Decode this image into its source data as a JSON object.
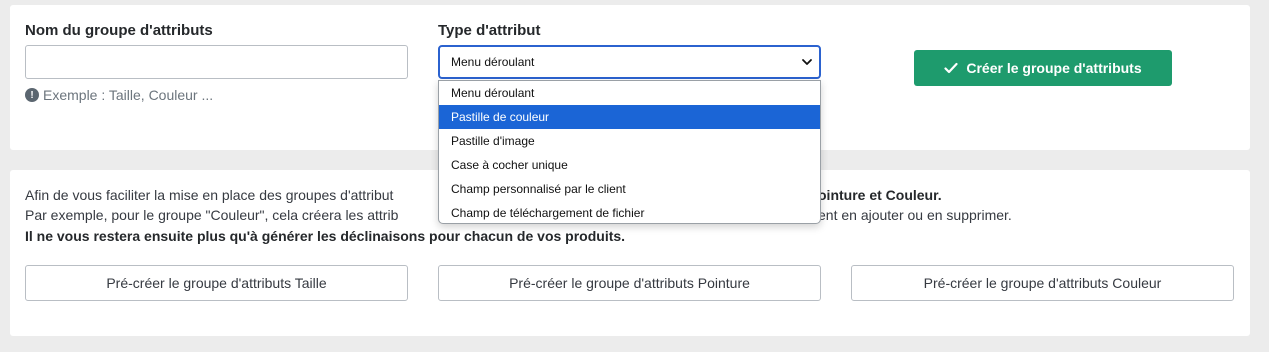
{
  "form": {
    "name_label": "Nom du groupe d'attributs",
    "name_value": "",
    "name_hint": "Exemple : Taille, Couleur ...",
    "type_label": "Type d'attribut",
    "type_selected": "Menu déroulant",
    "type_options": [
      "Menu déroulant",
      "Pastille de couleur",
      "Pastille d'image",
      "Case à cocher unique",
      "Champ personnalisé par le client",
      "Champ de téléchargement de fichier"
    ],
    "highlighted_option_index": 1,
    "create_button_label": "Créer le groupe d'attributs"
  },
  "info": {
    "line1_start": "Afin de vous faciliter la mise en place des groupes d'attribut",
    "line1_bold_tail": "ointure et Couleur.",
    "line2_start": "Par exemple, pour le groupe \"Couleur\", cela créera les attrib",
    "line2_tail": "ent en ajouter ou en supprimer.",
    "line3_bold": "Il ne vous restera ensuite plus qu'à générer les déclinaisons pour chacun de vos produits."
  },
  "precreate_buttons": [
    "Pré-créer le groupe d'attributs Taille",
    "Pré-créer le groupe d'attributs Pointure",
    "Pré-créer le groupe d'attributs Couleur"
  ],
  "colors": {
    "primary_green": "#1e9b6d",
    "select_focus_blue": "#2b62cf",
    "option_highlight_blue": "#1b65d6"
  }
}
